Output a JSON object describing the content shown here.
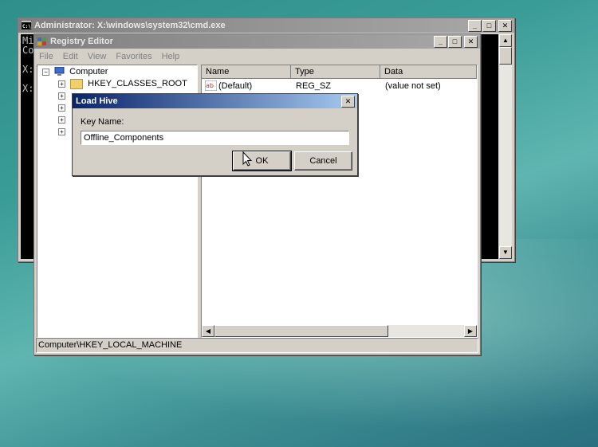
{
  "cmd_window": {
    "title": "Administrator: X:\\windows\\system32\\cmd.exe",
    "lines": [
      "Mi",
      "Co",
      "",
      "X:",
      "",
      "X:"
    ]
  },
  "regedit": {
    "title": "Registry Editor",
    "menu": [
      "File",
      "Edit",
      "View",
      "Favorites",
      "Help"
    ],
    "tree_root": "Computer",
    "tree_first": "HKEY_CLASSES_ROOT",
    "columns": {
      "name": "Name",
      "type": "Type",
      "data": "Data"
    },
    "rows": [
      {
        "name": "(Default)",
        "type": "REG_SZ",
        "data": "(value not set)"
      }
    ],
    "status": "Computer\\HKEY_LOCAL_MACHINE"
  },
  "dialog": {
    "title": "Load Hive",
    "label": "Key Name:",
    "value": "Offline_Components",
    "ok": "OK",
    "cancel": "Cancel"
  },
  "icons": {
    "cmd": "cmd-icon",
    "regedit": "regedit-icon",
    "computer": "computer-icon",
    "folder": "folder-icon",
    "string_value": "string-value-icon",
    "cursor": "mouse-cursor-icon"
  }
}
